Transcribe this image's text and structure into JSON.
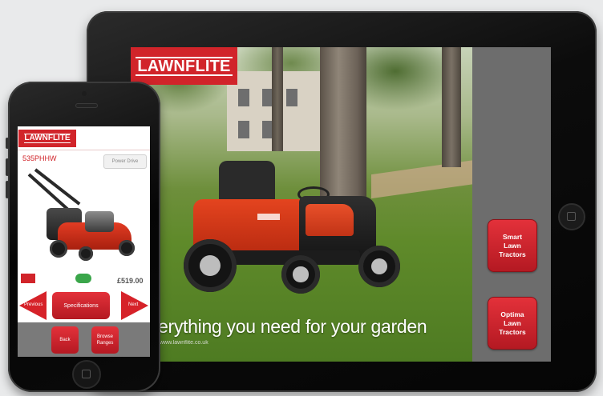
{
  "tablet": {
    "brand_logo": "LAWNFLITE",
    "tagline": "erything you need for your garden",
    "website": "www.lawnflite.co.uk",
    "buttons": [
      {
        "label": "Smart\nLawn\nTractors"
      },
      {
        "label": "Optima\nLawn\nTractors"
      }
    ]
  },
  "phone": {
    "brand_logo": "LAWNFLITE",
    "model": "535PHHW",
    "power_drive_label": "Power Drive",
    "price": "£519.00",
    "nav": {
      "previous_label": "Previous",
      "specifications_label": "Specifications",
      "next_label": "Next"
    },
    "footer": {
      "back_label": "Back",
      "browse_ranges_label": "Browse\nRanges"
    }
  },
  "colors": {
    "brand_red": "#d1242a",
    "panel_gray": "#6d6d6d"
  }
}
